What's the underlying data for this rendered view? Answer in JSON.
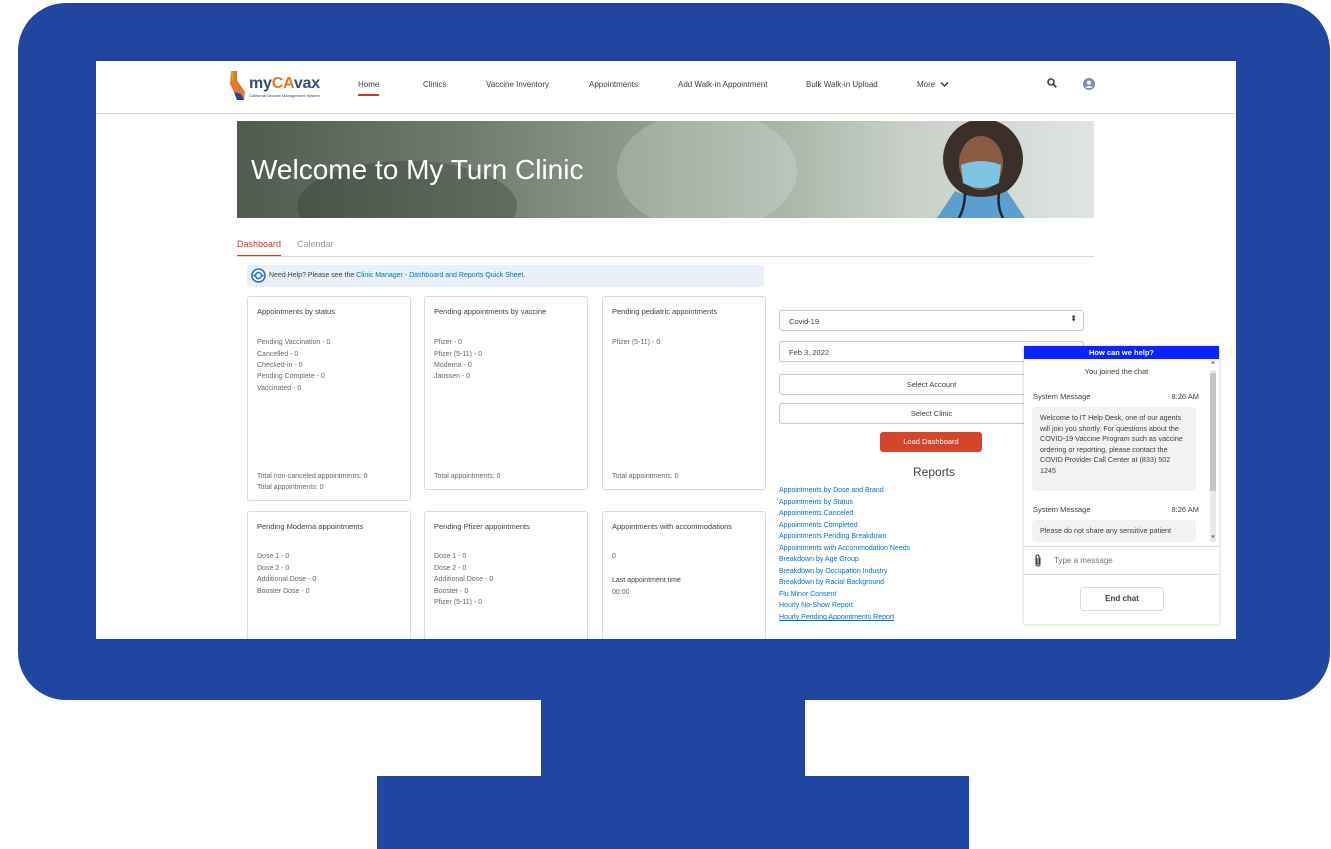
{
  "colors": {
    "frame": "#2146a1",
    "accent_red": "#c23934",
    "link": "#0070d2",
    "chat_header": "#0b24fb",
    "button_red": "#d4452a"
  },
  "logo": {
    "prefix": "my",
    "ca": "CA",
    "suffix": "vax",
    "subtitle": "California Vaccine Management System"
  },
  "nav": {
    "items": [
      "Home",
      "Clinics",
      "Vaccine Inventory",
      "Appointments",
      "Add Walk-in Appointment",
      "Bulk Walk-in Upload",
      "More"
    ],
    "more_icon": "chevron-down-icon",
    "search_icon": "search-icon",
    "user_icon": "user-avatar-icon"
  },
  "banner": {
    "title": "Welcome to My Turn Clinic"
  },
  "tabs": [
    "Dashboard",
    "Calendar"
  ],
  "help": {
    "prefix": "Need Help? Please see the ",
    "link": "Clinic Manager - Dashboard and Reports Quick Sheet",
    "suffix": ".",
    "icon": "help-lifebuoy-icon"
  },
  "cards": [
    {
      "title": "Appointments by status",
      "lines": [
        "Pending Vaccination - 0",
        "Cancelled - 0",
        "Checked-in - 0",
        "Pending Complete - 0",
        "Vaccinated - 0"
      ],
      "footer": [
        "Total non-canceled appointments: 0",
        "Total appointments: 0"
      ]
    },
    {
      "title": "Pending appointments by vaccine",
      "lines": [
        "Pfizer - 0",
        "Pfizer (5-11) - 0",
        "Moderna - 0",
        "Janssen - 0"
      ],
      "footer": [
        "Total appointments: 0"
      ]
    },
    {
      "title": "Pending pediatric appointments",
      "lines": [
        "Pfizer (5-11) - 0"
      ],
      "footer": [
        "Total appointments: 0"
      ]
    },
    {
      "title": "Pending Moderna appointments",
      "lines": [
        "Dose 1 - 0",
        "Dose 2 - 0",
        "Additional Dose - 0",
        "Booster Dose - 0"
      ]
    },
    {
      "title": "Pending Pfizer appointments",
      "lines": [
        "Dose 1 - 0",
        "Dose 2 - 0",
        "Additional Dose - 0",
        "Booster - 0",
        "Pfizer (5-11) - 0"
      ]
    },
    {
      "title": "Appointments with accommodations",
      "value": "0",
      "subtitle": "Last appointment time",
      "time": "00:00"
    }
  ],
  "filters": {
    "vaccine": "Covid-19",
    "date": "Feb 3, 2022",
    "select_account": "Select Account",
    "select_clinic": "Select Clinic",
    "load_button": "Load Dashboard"
  },
  "reports": {
    "title": "Reports",
    "links": [
      "Appointments by Dose and Brand",
      "Appointments by Status",
      "Appointments Canceled",
      "Appointments Completed",
      "Appointments Pending Breakdown",
      "Appointments with Accommodation Needs",
      "Breakdown by Age Group",
      "Breakdown by Occupation Industry",
      "Breakdown by Racial Background",
      "Flu Minor Consent",
      "Hourly No-Show Report",
      "Hourly Pending Appointments Report"
    ]
  },
  "chat": {
    "header": "How can we help?",
    "joined": "You joined the chat",
    "messages": [
      {
        "sender": "System Message",
        "time": "8:26 AM",
        "text": "Welcome to IT Help Desk, one of our agents will join you shortly. For questions about the COVID-19 Vaccine Program such as vaccine ordering or reporting, please contact the COVID Provider Call Center at (833) 502 1245"
      },
      {
        "sender": "System Message",
        "time": "8:26 AM",
        "text": "Please do not share any sensitive patient"
      }
    ],
    "input_placeholder": "Type a message",
    "attach_icon": "paperclip-icon",
    "end_button": "End chat"
  }
}
